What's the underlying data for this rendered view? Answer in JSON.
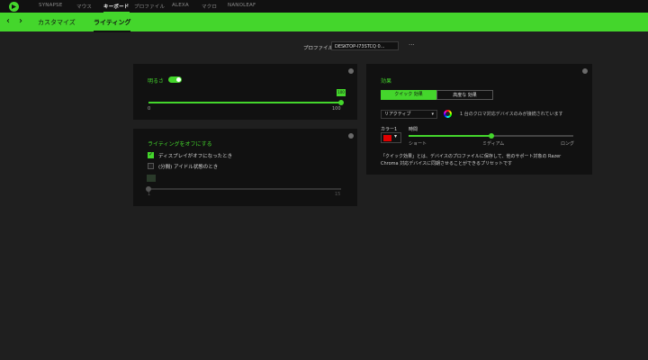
{
  "nav": {
    "tabs": [
      "SYNAPSE",
      "マウス",
      "キーボード",
      "プロファイル",
      "ALEXA",
      "マクロ",
      "NANOLEAF"
    ],
    "active_index": 2
  },
  "subnav": {
    "back_icon": "chevron-left-icon",
    "forward_icon": "chevron-right-icon",
    "tabs": [
      "カスタマイズ",
      "ライティング"
    ],
    "active_index": 1
  },
  "profile": {
    "label": "プロファイル",
    "value": "DESKTOP-I73STCQ 0...",
    "more": "···"
  },
  "brightness": {
    "title": "明るさ",
    "enabled": true,
    "value": 100,
    "badge": "100",
    "min_label": "0",
    "max_label": "100",
    "level": 1.0
  },
  "lighting_off": {
    "title": "ライティングをオフにする",
    "option1": {
      "label": "ディスプレイがオフになったとき",
      "checked": true
    },
    "option2": {
      "label": "(分間) アイドル状態のとき",
      "checked": false
    },
    "slider_min": "1",
    "slider_max": "15",
    "level": 0.0
  },
  "effects": {
    "title": "効果",
    "tab_quick": "クイック 効果",
    "tab_advanced": "高度な 効果",
    "active_tab": "quick",
    "effect_value": "リアクティブ",
    "chroma_note": "1 台のクロマ対応デバイスのみが接続されています",
    "color_label": "カラー1",
    "color_value": "#e00000",
    "duration_label": "時間",
    "duration_short": "ショート",
    "duration_medium": "ミディアム",
    "duration_long": "ロング",
    "duration_level": 0.5,
    "description_line1": "「クイック効果」とは、デバイスのプロファイルに保存して、他のサポート対象の Razer",
    "description_line2": "Chroma 対応デバイスに同期させることができるプリセットです"
  },
  "colors": {
    "accent": "#44d62c",
    "panel": "#111111",
    "background": "#1f1f1f"
  }
}
